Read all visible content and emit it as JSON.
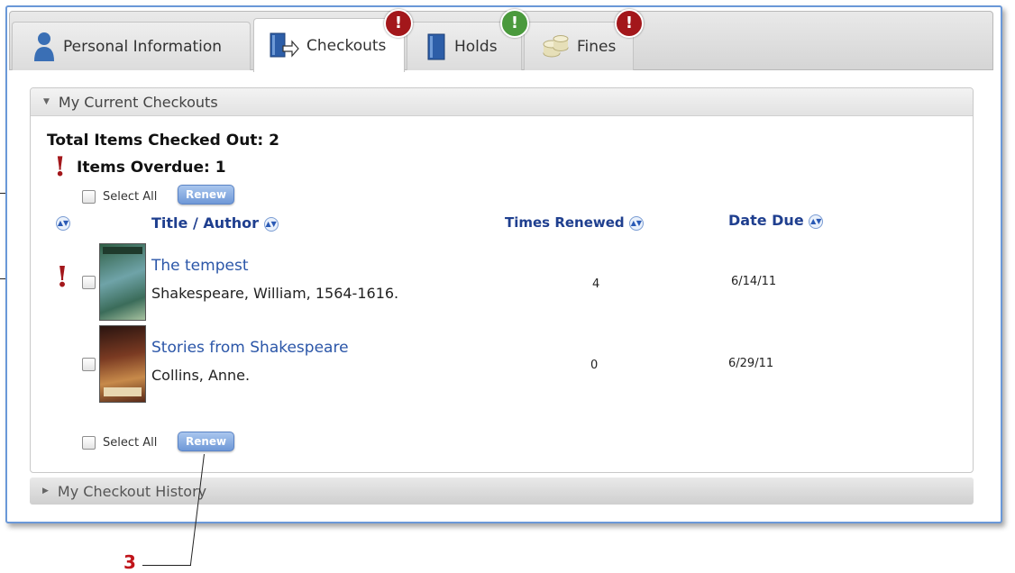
{
  "tabs": [
    {
      "label": "Personal Information",
      "icon": "person-icon",
      "active": false
    },
    {
      "label": "Checkouts",
      "icon": "checkout-book-icon",
      "active": true,
      "alert": "!",
      "alert_color": "#a3171b"
    },
    {
      "label": "Holds",
      "icon": "book-icon",
      "active": false,
      "alert": "!",
      "alert_color": "#4a9a3d"
    },
    {
      "label": "Fines",
      "icon": "coins-icon",
      "active": false,
      "alert": "!",
      "alert_color": "#a3171b"
    }
  ],
  "current_checkouts": {
    "header": "My Current Checkouts",
    "total_label": "Total Items Checked Out: 2",
    "overdue_label": "Items Overdue: 1",
    "overdue_mark": "!",
    "select_all": "Select All",
    "renew": "Renew",
    "columns": {
      "title_author": "Title / Author",
      "times_renewed": "Times Renewed",
      "date_due": "Date Due"
    },
    "items": [
      {
        "title": "The tempest",
        "author": "Shakespeare, William, 1564-1616.",
        "times_renewed": "4",
        "date_due": "6/14/11",
        "overdue": true,
        "overdue_mark": "!",
        "cover_colors": [
          "#3a6b4e",
          "#6fa3a8"
        ]
      },
      {
        "title": "Stories from Shakespeare",
        "author": "Collins, Anne.",
        "times_renewed": "0",
        "date_due": "6/29/11",
        "overdue": false,
        "cover_colors": [
          "#6b2a1a",
          "#c78a4a"
        ]
      }
    ],
    "select_all_bottom": "Select All",
    "renew_bottom": "Renew"
  },
  "history": {
    "header": "My Checkout History"
  },
  "callout": {
    "label": "3",
    "color": "#c0141a"
  },
  "colors": {
    "accent": "#2b56a8",
    "overdue": "#a3171b",
    "frame": "#6a98d8"
  }
}
